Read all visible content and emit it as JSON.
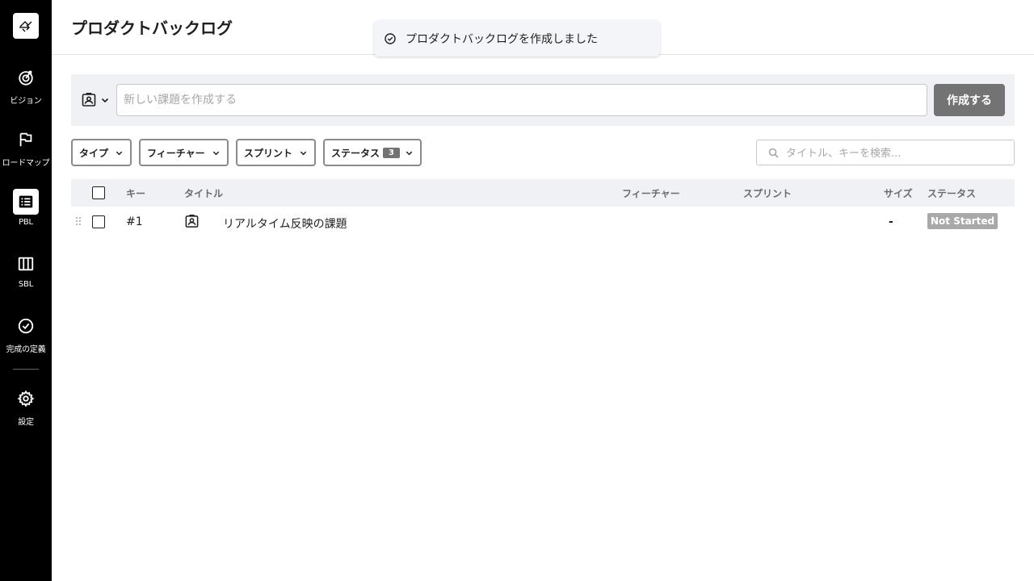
{
  "header": {
    "title": "プロダクトバックログ"
  },
  "toast": {
    "message": "プロダクトバックログを作成しました"
  },
  "sidebar": {
    "items": [
      {
        "label": "ビジョン",
        "icon": "vision-icon"
      },
      {
        "label": "ロードマップ",
        "icon": "flag-icon"
      },
      {
        "label": "PBL",
        "icon": "list-icon",
        "active": true
      },
      {
        "label": "SBL",
        "icon": "columns-icon"
      },
      {
        "label": "完成の定義",
        "icon": "check-circle-icon"
      },
      {
        "label": "設定",
        "icon": "gear-icon"
      }
    ]
  },
  "create_bar": {
    "input_placeholder": "新しい課題を作成する",
    "input_value": "",
    "create_label": "作成する",
    "type_icon": "user-story-icon"
  },
  "filters": {
    "type_label": "タイプ",
    "feature_label": "フィーチャー",
    "sprint_label": "スプリント",
    "status_label": "ステータス",
    "status_count": "3",
    "search_placeholder": "タイトル、キーを検索..."
  },
  "table": {
    "columns": {
      "key": "キー",
      "title": "タイトル",
      "feature": "フィーチャー",
      "sprint": "スプリント",
      "size": "サイズ",
      "status": "ステータス"
    },
    "rows": [
      {
        "key": "#1",
        "type_icon": "user-story-icon",
        "title": "リアルタイム反映の課題",
        "feature": "",
        "sprint": "",
        "size": "-",
        "status": "Not Started"
      }
    ]
  },
  "colors": {
    "sidebar_bg": "#000000",
    "accent_button": "#737373",
    "status_not_started": "#a9a9a9",
    "panel_bg": "#f0f1f4"
  }
}
